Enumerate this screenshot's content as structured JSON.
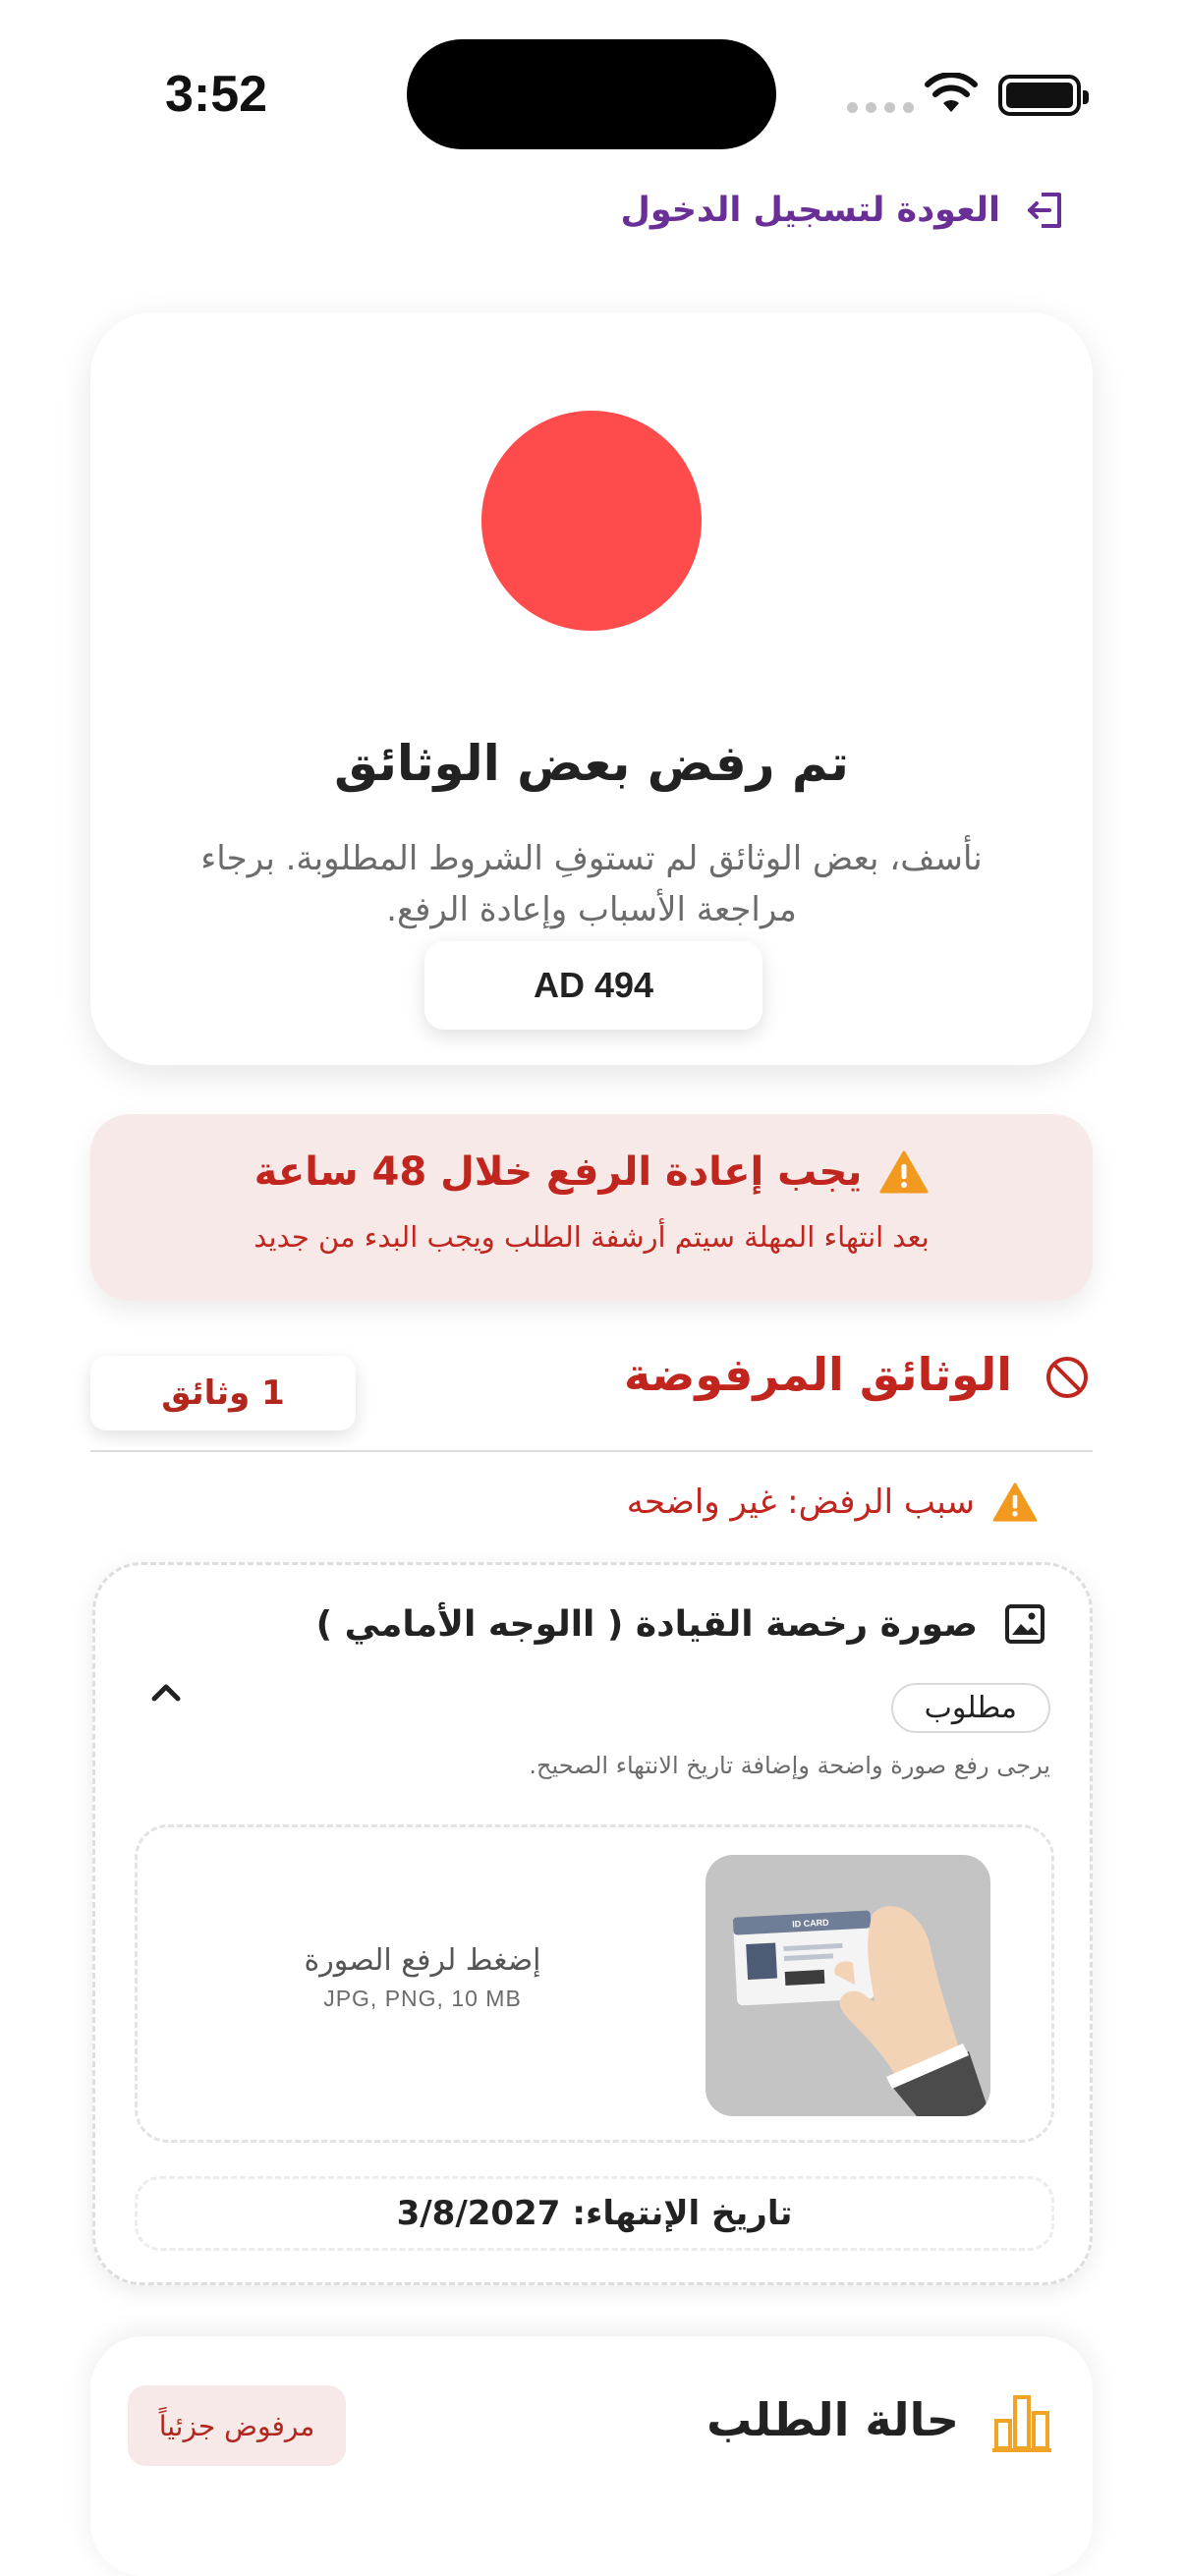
{
  "status_bar": {
    "time": "3:52"
  },
  "header": {
    "back_label": "العودة لتسجيل الدخول",
    "back_icon": "logout-arrow-icon"
  },
  "status_card": {
    "indicator_color": "#fe4c4c",
    "title": "تم رفض بعض الوثائق",
    "description": "نأسف، بعض الوثائق لم تستوفِ الشروط المطلوبة. برجاء مراجعة الأسباب وإعادة الرفع.",
    "plate_number": "AD 494"
  },
  "deadline_banner": {
    "title": "يجب إعادة الرفع خلال 48 ساعة",
    "subtitle": "بعد انتهاء المهلة سيتم أرشفة الطلب ويجب البدء من جديد",
    "icon": "warning-icon"
  },
  "rejected_section": {
    "title": "الوثائق المرفوضة",
    "icon": "ban-icon",
    "count_label": "1 وثائق",
    "reason": "سبب الرفض: غير واضحه"
  },
  "document": {
    "title": "صورة رخصة القيادة ( االوجه الأمامي )",
    "icon": "image-icon",
    "required_label": "مطلوب",
    "hint": "يرجى رفع صورة واضحة وإضافة تاريخ الانتهاء الصحيح.",
    "upload_label": "إضغط لرفع الصورة",
    "upload_formats": "JPG, PNG, 10 MB",
    "sample_card_label": "ID CARD",
    "expiry_label": "تاريخ الإنتهاء:",
    "expiry_value": "3/8/2027"
  },
  "order_status": {
    "title": "حالة الطلب",
    "icon": "bar-chart-icon",
    "badge": "مرفوض جزئياً"
  },
  "colors": {
    "brand_purple": "#6a2f96",
    "danger": "#c0251e",
    "danger_bg": "#f7e9e8",
    "warning": "#f29a1f",
    "chart_orange": "#f0a324"
  }
}
